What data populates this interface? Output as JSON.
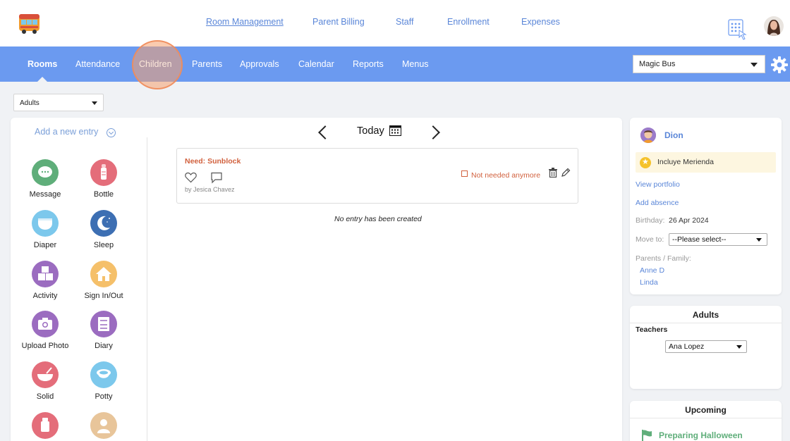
{
  "top_nav": {
    "links": [
      "Room Management",
      "Parent Billing",
      "Staff",
      "Enrollment",
      "Expenses"
    ],
    "active": "Room Management"
  },
  "main_nav": {
    "items": [
      "Rooms",
      "Attendance",
      "Children",
      "Parents",
      "Approvals",
      "Calendar",
      "Reports",
      "Menus"
    ],
    "active": "Rooms"
  },
  "school_select": {
    "value": "Magic Bus"
  },
  "room_select": {
    "value": "Adults"
  },
  "entries": {
    "add_label": "Add a new entry",
    "tiles": [
      {
        "label": "Message",
        "icon": "message-icon",
        "color": "#5fae7a"
      },
      {
        "label": "Bottle",
        "icon": "bottle-icon",
        "color": "#e46d7a"
      },
      {
        "label": "Diaper",
        "icon": "diaper-icon",
        "color": "#7cc8ec"
      },
      {
        "label": "Sleep",
        "icon": "moon-icon",
        "color": "#3d6fb3"
      },
      {
        "label": "Activity",
        "icon": "blocks-icon",
        "color": "#9b6cc0"
      },
      {
        "label": "Sign In/Out",
        "icon": "house-icon",
        "color": "#f5c06a"
      },
      {
        "label": "Upload Photo",
        "icon": "camera-icon",
        "color": "#9b6cc0"
      },
      {
        "label": "Diary",
        "icon": "diary-icon",
        "color": "#9b6cc0"
      },
      {
        "label": "Solid",
        "icon": "bowl-icon",
        "color": "#e46d7a"
      },
      {
        "label": "Potty",
        "icon": "potty-icon",
        "color": "#7cc8ec"
      },
      {
        "label": "",
        "icon": "sippy-cup-icon",
        "color": "#e46d7a"
      },
      {
        "label": "",
        "icon": "person-icon",
        "color": "#e8c59a"
      }
    ]
  },
  "date_nav": {
    "label": "Today"
  },
  "note": {
    "title": "Need: Sunblock",
    "author": "by Jesica Chavez",
    "not_needed_label": "Not needed anymore"
  },
  "empty_message": "No entry has been created",
  "child": {
    "name": "Dion",
    "snack_label": "Incluye Merienda",
    "view_portfolio": "View portfolio",
    "add_absence": "Add absence",
    "birthday_label": "Birthday:",
    "birthday_value": "26 Apr 2024",
    "move_to_label": "Move to:",
    "move_to_value": "--Please select--",
    "parents_label": "Parents / Family:",
    "parents": [
      "Anne D",
      "Linda"
    ]
  },
  "adults_panel": {
    "title": "Adults",
    "teachers_label": "Teachers",
    "teacher_value": "Ana Lopez"
  },
  "upcoming": {
    "title": "Upcoming",
    "event": "Preparing Halloween"
  },
  "colors": {
    "nav_blue": "#6b9af0",
    "link_blue": "#5a86d8",
    "alert_orange": "#d1603d",
    "event_green": "#5fae7a"
  }
}
